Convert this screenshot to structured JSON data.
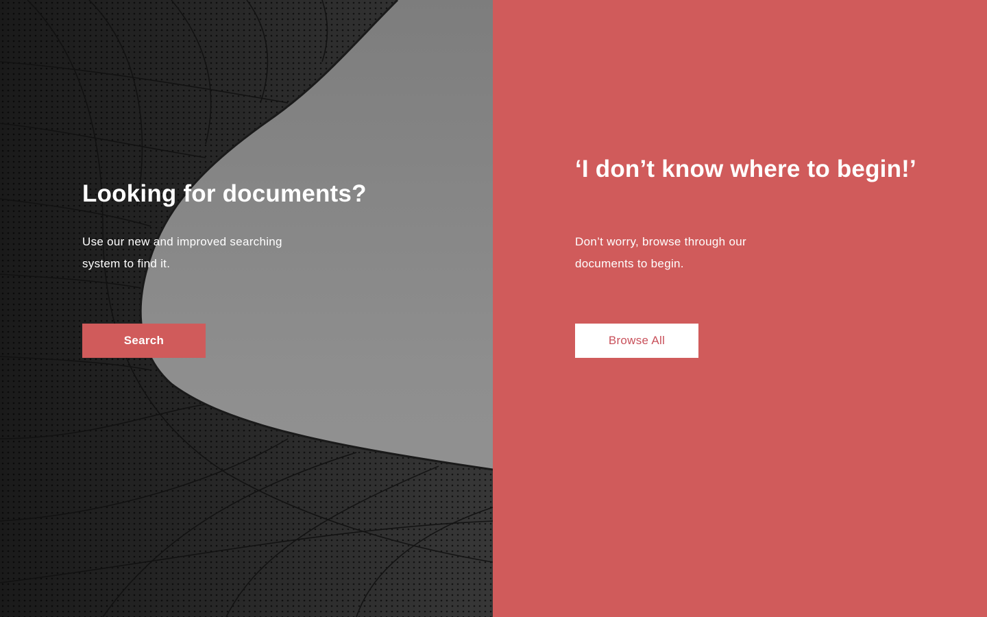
{
  "colors": {
    "accent_red": "#d05b5b",
    "text_white": "#ffffff",
    "browse_text": "#c8505a"
  },
  "left_panel": {
    "image_icon": "architecture-photo",
    "title": "Looking for documents?",
    "description": "Use our new and improved searching system to find it.",
    "button_label": "Search"
  },
  "right_panel": {
    "title": "‘I don’t know where to begin!’",
    "description": "Don’t worry, browse through our documents to begin.",
    "button_label": "Browse All"
  }
}
